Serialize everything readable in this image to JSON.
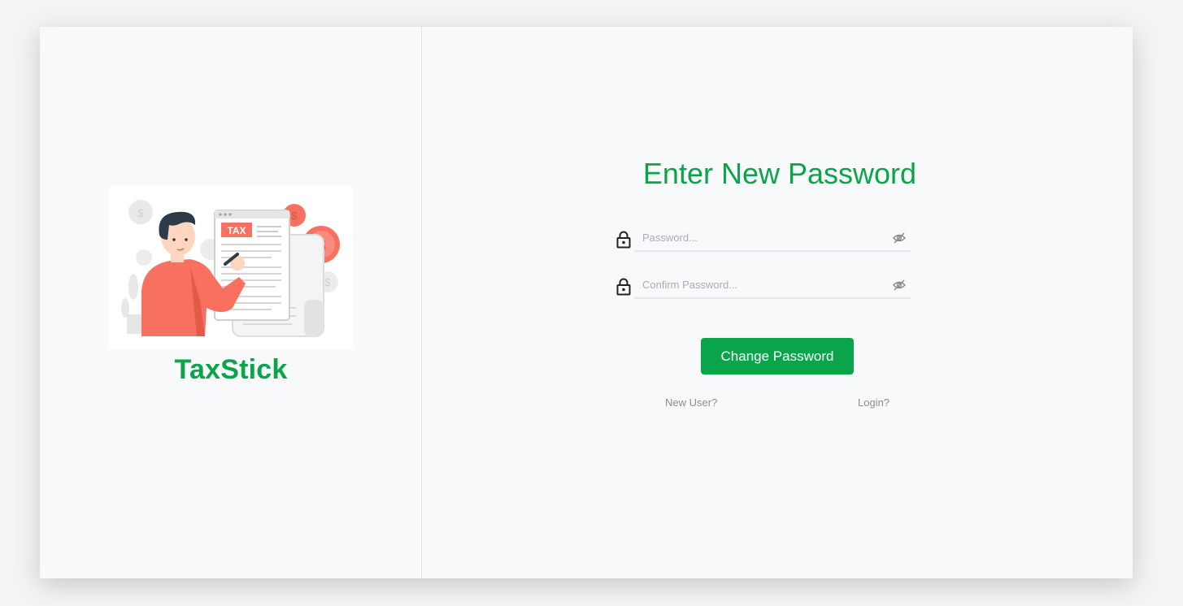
{
  "brand": {
    "illustration_label": "TAX",
    "name": "TaxStick"
  },
  "form": {
    "title": "Enter New Password",
    "password_placeholder": "Password...",
    "confirm_placeholder": "Confirm Password...",
    "submit_label": "Change Password",
    "new_user_link": "New User?",
    "login_link": "Login?"
  },
  "colors": {
    "accent": "#0aa54a",
    "illustration_accent": "#f87060"
  },
  "icons": [
    "lock-icon",
    "eye-slash-icon",
    "dollar-coin-icon"
  ]
}
